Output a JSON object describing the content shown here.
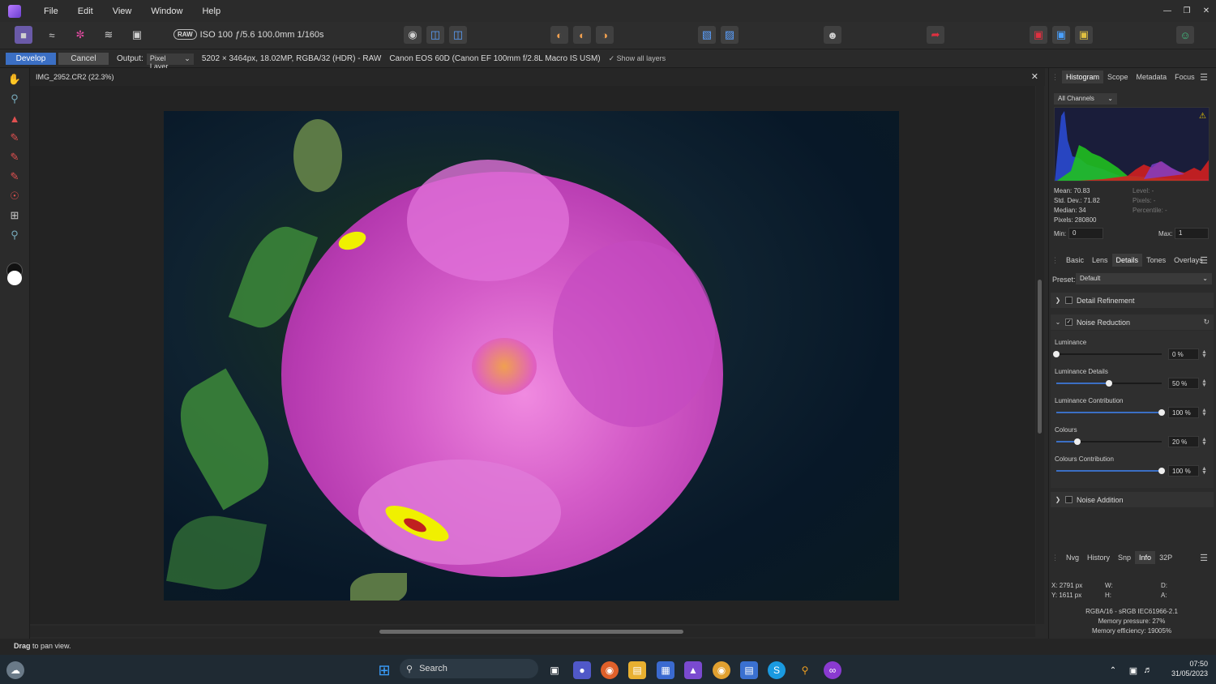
{
  "menu": {
    "items": [
      "File",
      "Edit",
      "View",
      "Window",
      "Help"
    ]
  },
  "toolbar": {
    "raw_badge": "RAW",
    "exif": "ISO 100 ƒ/5.6 100.0mm 1/160s"
  },
  "context": {
    "develop": "Develop",
    "cancel": "Cancel",
    "output_label": "Output:",
    "output_value": "Pixel Layer",
    "image_info": "5202 × 3464px, 18.02MP, RGBA/32 (HDR) - RAW",
    "camera": "Canon EOS 60D (Canon EF 100mm f/2.8L Macro IS USM)",
    "show_all_layers": "Show all layers"
  },
  "document": {
    "tab_title": "IMG_2952.CR2 (22.3%)"
  },
  "status": {
    "bold": "Drag",
    "rest": " to pan view."
  },
  "histogram_panel": {
    "tabs": [
      "Histogram",
      "Scope",
      "Metadata",
      "Focus"
    ],
    "channel": "All Channels",
    "mean": "Mean: 70.83",
    "std_dev": "Std. Dev.: 71.82",
    "median": "Median: 34",
    "pixels": "Pixels: 280800",
    "level": "Level: -",
    "pixels_r": "Pixels: -",
    "percentile": "Percentile: -",
    "min_label": "Min:",
    "min_value": "0",
    "max_label": "Max:",
    "max_value": "1"
  },
  "develop_panel": {
    "tabs": [
      "Basic",
      "Lens",
      "Details",
      "Tones",
      "Overlays"
    ],
    "preset_label": "Preset:",
    "preset_value": "Default",
    "sections": {
      "detail_refinement": "Detail Refinement",
      "noise_reduction": "Noise Reduction",
      "noise_addition": "Noise Addition"
    },
    "sliders": [
      {
        "label": "Luminance",
        "value": "0 %",
        "level": 0
      },
      {
        "label": "Luminance Details",
        "value": "50 %",
        "level": 0.5
      },
      {
        "label": "Luminance Contribution",
        "value": "100 %",
        "level": 1
      },
      {
        "label": "Colours",
        "value": "20 %",
        "level": 0.2
      },
      {
        "label": "Colours Contribution",
        "value": "100 %",
        "level": 1
      }
    ]
  },
  "info_panel": {
    "tabs": [
      "Nvg",
      "History",
      "Snp",
      "Info",
      "32P"
    ],
    "x": "X: 2791 px",
    "y": "Y: 1611 px",
    "w": "W:",
    "h": "H:",
    "d": "D:",
    "a": "A:",
    "format": "RGBA/16 - sRGB IEC61966-2.1",
    "memory_pressure": "Memory pressure: 27%",
    "memory_efficiency": "Memory efficiency: 19005%"
  },
  "taskbar": {
    "search": "Search",
    "time": "07:50",
    "date": "31/05/2023"
  }
}
